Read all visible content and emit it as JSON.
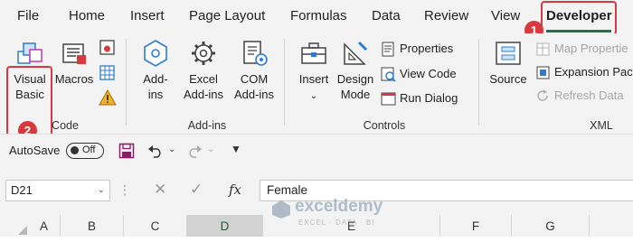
{
  "tabs": [
    "File",
    "Home",
    "Insert",
    "Page Layout",
    "Formulas",
    "Data",
    "Review",
    "View",
    "Developer"
  ],
  "callouts": {
    "developer": "1",
    "visual_basic": "2"
  },
  "ribbon": {
    "code": {
      "group_label": "Code",
      "visual_basic": [
        "Visual",
        "Basic"
      ],
      "macros": "Macros"
    },
    "addins": {
      "group_label": "Add-ins",
      "addins_btn": [
        "Add-",
        "ins"
      ],
      "excel_addins": [
        "Excel",
        "Add-ins"
      ],
      "com_addins": [
        "COM",
        "Add-ins"
      ]
    },
    "controls": {
      "group_label": "Controls",
      "insert": "Insert",
      "design_mode": [
        "Design",
        "Mode"
      ],
      "properties": "Properties",
      "view_code": "View Code",
      "run_dialog": "Run Dialog"
    },
    "xml": {
      "group_label": "XML",
      "source": "Source",
      "map_properties": "Map Propertie",
      "expansion_packs": "Expansion Pack",
      "refresh_data": "Refresh Data"
    }
  },
  "qat": {
    "autosave_label": "AutoSave",
    "autosave_state": "Off"
  },
  "formula_bar": {
    "name_box": "D21",
    "fx": "fx",
    "value": "Female"
  },
  "columns": [
    "A",
    "B",
    "C",
    "D",
    "E",
    "F",
    "G"
  ],
  "selected_column": "D",
  "watermark": {
    "name": "exceldemy",
    "tagline": "EXCEL · DATA · BI"
  },
  "colors": {
    "accent": "#217346",
    "callout": "#d8393f"
  }
}
